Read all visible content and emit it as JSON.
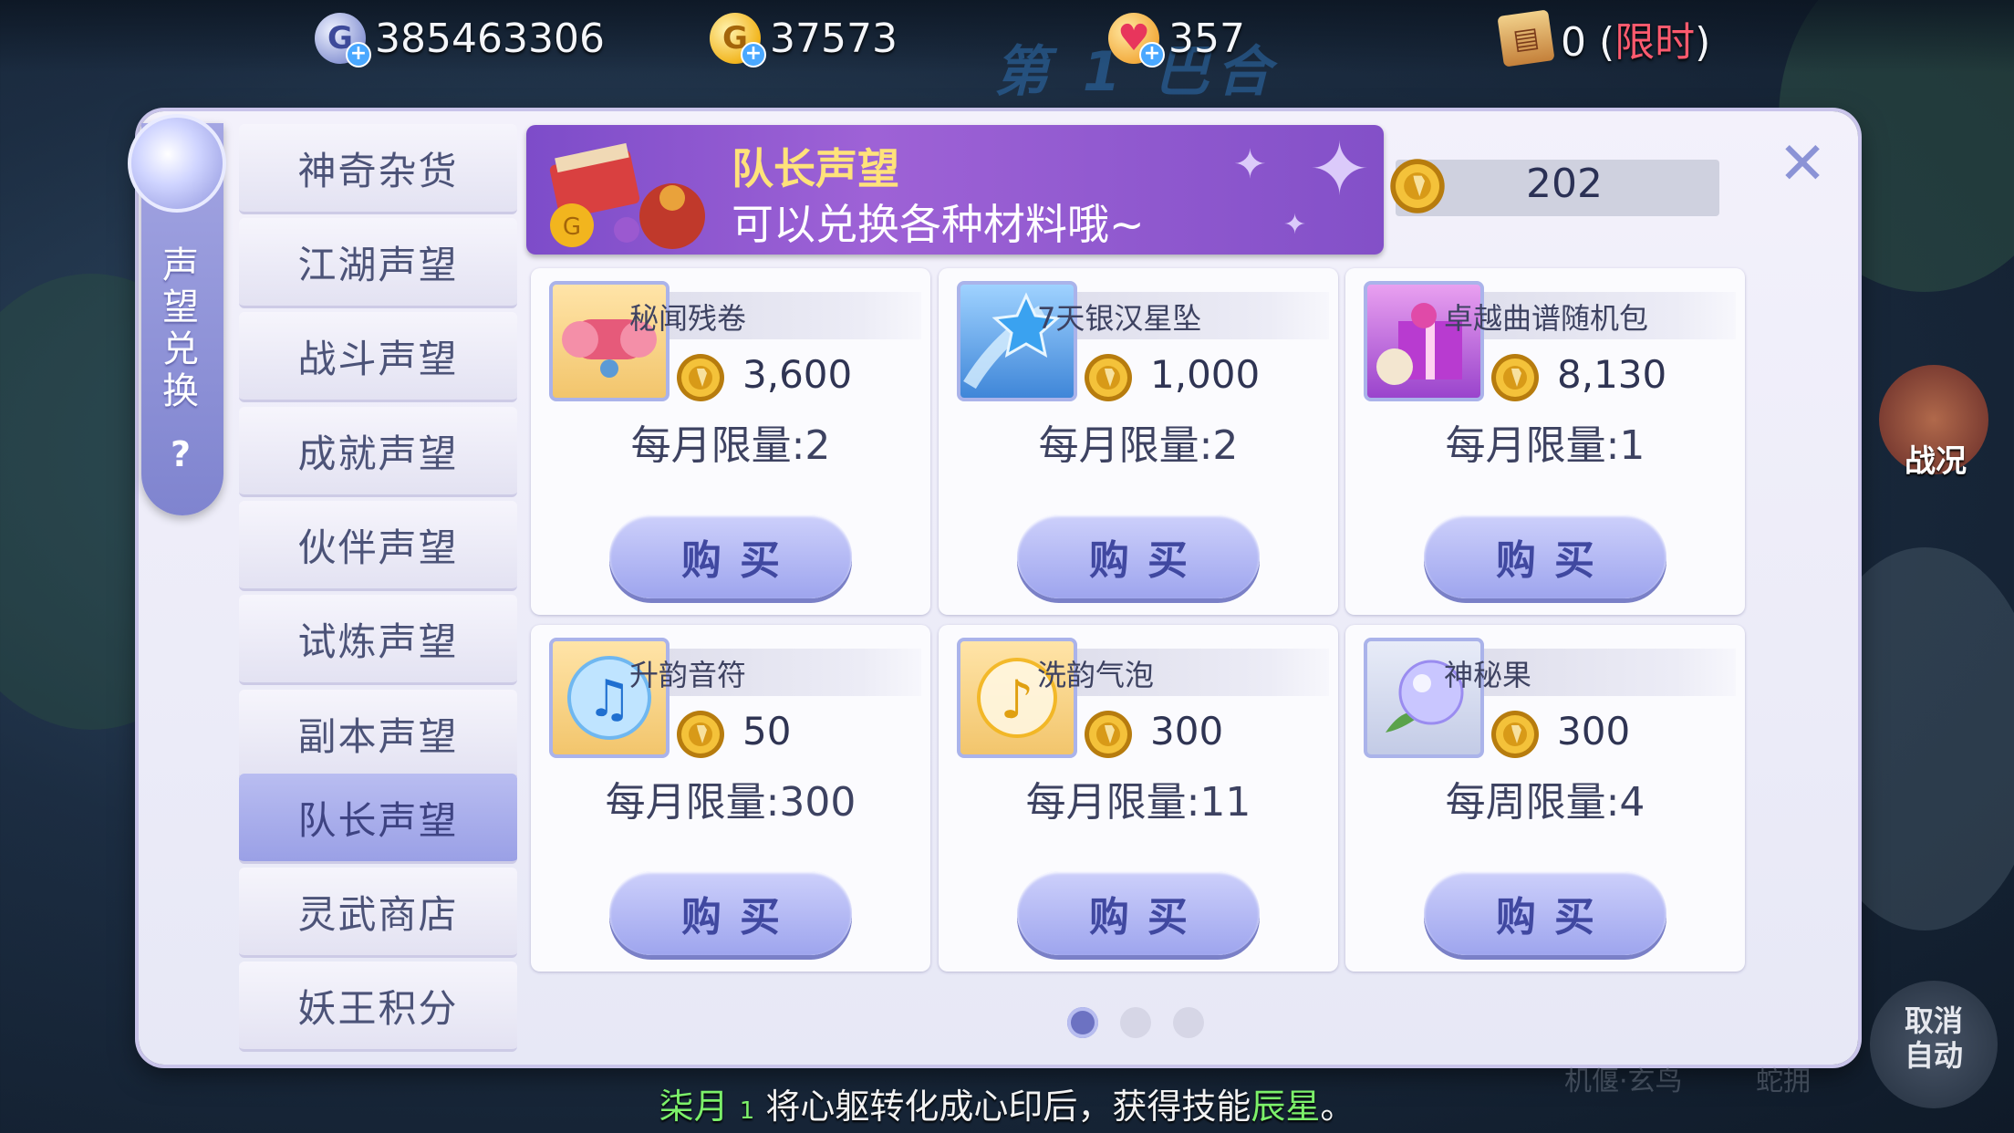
{
  "currencies": [
    {
      "icon": "g-silver-currency-icon",
      "value": "385463306"
    },
    {
      "icon": "g-gold-currency-icon",
      "value": "37573"
    },
    {
      "icon": "heart-currency-icon",
      "value": "357"
    },
    {
      "icon": "ticket-currency-icon",
      "value": "0",
      "paren_open": " (",
      "limited": "限时",
      "paren_close": ")"
    }
  ],
  "bg_title": "第 1 巴合",
  "side_ribbon": {
    "title": "声望兑换",
    "help": "?"
  },
  "tabs": [
    {
      "label": "神奇杂货"
    },
    {
      "label": "江湖声望"
    },
    {
      "label": "战斗声望"
    },
    {
      "label": "成就声望"
    },
    {
      "label": "伙伴声望"
    },
    {
      "label": "试炼声望"
    },
    {
      "label": "副本声望"
    },
    {
      "label": "队长声望",
      "active": true
    },
    {
      "label": "灵武商店"
    },
    {
      "label": "妖王积分"
    }
  ],
  "banner": {
    "title": "队长声望",
    "desc": "可以兑换各种材料哦~"
  },
  "balance": "202",
  "close": "✕",
  "items": [
    {
      "name": "秘闻残卷",
      "price": "3,600",
      "limit": "每月限量:2",
      "buy": "购买",
      "icon": "scroll-icon"
    },
    {
      "name": "7天银汉星坠",
      "price": "1,000",
      "limit": "每月限量:2",
      "buy": "购买",
      "icon": "star-icon"
    },
    {
      "name": "卓越曲谱随机包",
      "price": "8,130",
      "limit": "每月限量:1",
      "buy": "购买",
      "icon": "gift-box-icon"
    },
    {
      "name": "升韵音符",
      "price": "50",
      "limit": "每月限量:300",
      "buy": "购买",
      "icon": "music-note-icon"
    },
    {
      "name": "洗韵气泡",
      "price": "300",
      "limit": "每月限量:11",
      "buy": "购买",
      "icon": "bubble-note-icon"
    },
    {
      "name": "神秘果",
      "price": "300",
      "limit": "每周限量:4",
      "buy": "购买",
      "icon": "mystic-fruit-icon"
    }
  ],
  "pagination": {
    "pages": 3,
    "current": 1
  },
  "tip": {
    "who": "柒月",
    "mark": "1",
    "text": " 将心躯转化成心印后，获得技能",
    "skill": "辰星",
    "end": "。"
  },
  "right": {
    "battle": "战况",
    "auto": "取消自动"
  },
  "faint_skills": [
    "机偃·玄鸟",
    "蛇拥"
  ]
}
